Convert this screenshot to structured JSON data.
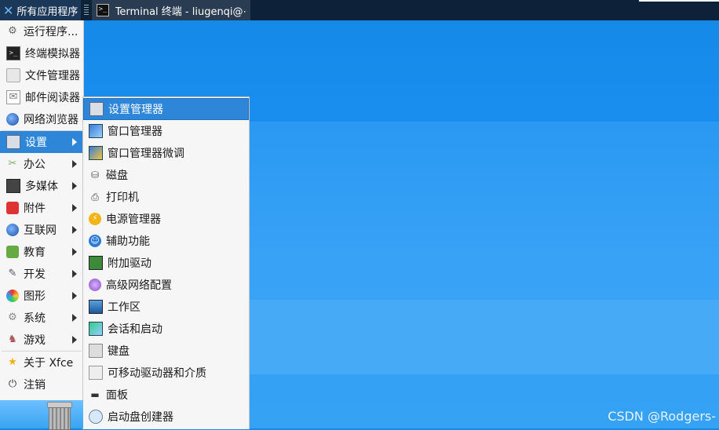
{
  "panel": {
    "apps_label": "所有应用程序",
    "task_label": "Terminal 终端 - liugenqi@⋯"
  },
  "menu": {
    "items": [
      {
        "label": "运行程序...",
        "icon": "gears-icon",
        "submenu": false
      },
      {
        "label": "终端模拟器",
        "icon": "terminal-icon",
        "submenu": false
      },
      {
        "label": "文件管理器",
        "icon": "folder-icon",
        "submenu": false
      },
      {
        "label": "邮件阅读器",
        "icon": "mail-icon",
        "submenu": false
      },
      {
        "label": "网络浏览器",
        "icon": "globe-icon",
        "submenu": false
      },
      {
        "label": "设置",
        "icon": "settings-icon",
        "submenu": true,
        "active": true
      },
      {
        "label": "办公",
        "icon": "office-icon",
        "submenu": true
      },
      {
        "label": "多媒体",
        "icon": "multimedia-icon",
        "submenu": true
      },
      {
        "label": "附件",
        "icon": "accessories-icon",
        "submenu": true
      },
      {
        "label": "互联网",
        "icon": "internet-icon",
        "submenu": true
      },
      {
        "label": "教育",
        "icon": "education-icon",
        "submenu": true
      },
      {
        "label": "开发",
        "icon": "development-icon",
        "submenu": true
      },
      {
        "label": "图形",
        "icon": "graphics-icon",
        "submenu": true
      },
      {
        "label": "系统",
        "icon": "system-icon",
        "submenu": true
      },
      {
        "label": "游戏",
        "icon": "games-icon",
        "submenu": true
      },
      {
        "label": "关于 Xfce",
        "icon": "star-icon",
        "submenu": false
      },
      {
        "label": "注销",
        "icon": "power-icon",
        "submenu": false
      }
    ]
  },
  "submenu": {
    "items": [
      {
        "label": "设置管理器",
        "icon": "settings-manager-icon",
        "active": true
      },
      {
        "label": "窗口管理器",
        "icon": "window-manager-icon"
      },
      {
        "label": "窗口管理器微调",
        "icon": "window-manager-tweaks-icon"
      },
      {
        "label": "磁盘",
        "icon": "disk-icon"
      },
      {
        "label": "打印机",
        "icon": "printer-icon"
      },
      {
        "label": "电源管理器",
        "icon": "power-manager-icon"
      },
      {
        "label": "辅助功能",
        "icon": "accessibility-icon"
      },
      {
        "label": "附加驱动",
        "icon": "driver-icon"
      },
      {
        "label": "高级网络配置",
        "icon": "network-icon"
      },
      {
        "label": "工作区",
        "icon": "workspace-icon"
      },
      {
        "label": "会话和启动",
        "icon": "session-icon"
      },
      {
        "label": "键盘",
        "icon": "keyboard-icon"
      },
      {
        "label": "可移动驱动器和介质",
        "icon": "removable-drive-icon"
      },
      {
        "label": "面板",
        "icon": "panel-icon"
      },
      {
        "label": "启动盘创建器",
        "icon": "startup-disk-icon"
      }
    ]
  },
  "watermark": "CSDN @Rodgers-"
}
